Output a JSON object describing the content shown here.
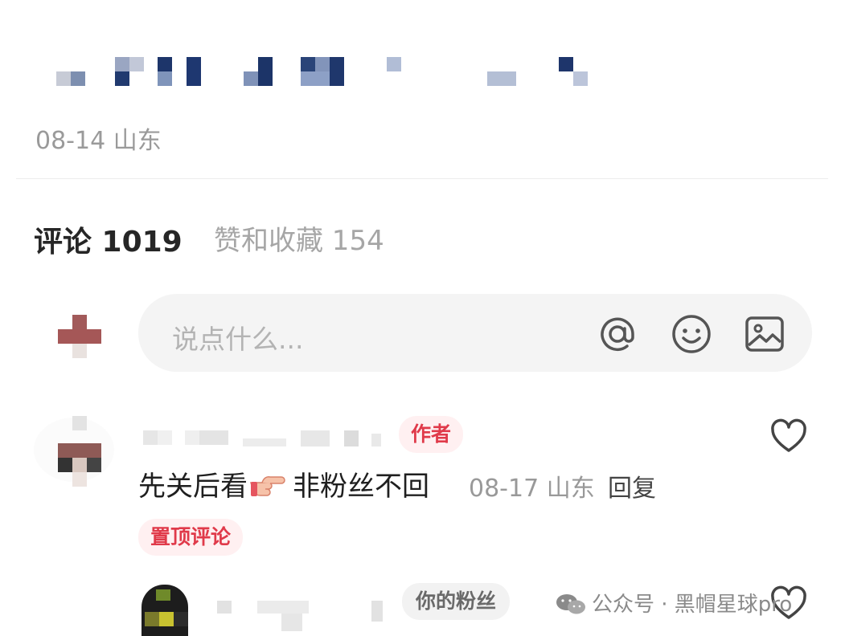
{
  "post": {
    "meta": "08-14 山东"
  },
  "tabs": [
    {
      "label": "评论 1019"
    },
    {
      "label": "赞和收藏 154"
    }
  ],
  "input": {
    "placeholder": "说点什么..."
  },
  "icons": {
    "mention": "at-icon",
    "emoji": "emoji-icon",
    "image": "image-icon",
    "like": "heart-icon",
    "wechat": "wechat-icon"
  },
  "comments": [
    {
      "author_badge": "作者",
      "text_before": "先关后看",
      "text_after": "非粉丝不回",
      "meta": "08-17 山东",
      "reply": "回复",
      "pinned_label": "置顶评论"
    },
    {
      "fan_badge": "你的粉丝"
    }
  ],
  "watermark": {
    "text": "公众号 · 黑帽星球pro"
  },
  "colors": {
    "accent": "#e03a4a",
    "muted": "#9a9a9a",
    "input_bg": "#f4f4f4"
  }
}
